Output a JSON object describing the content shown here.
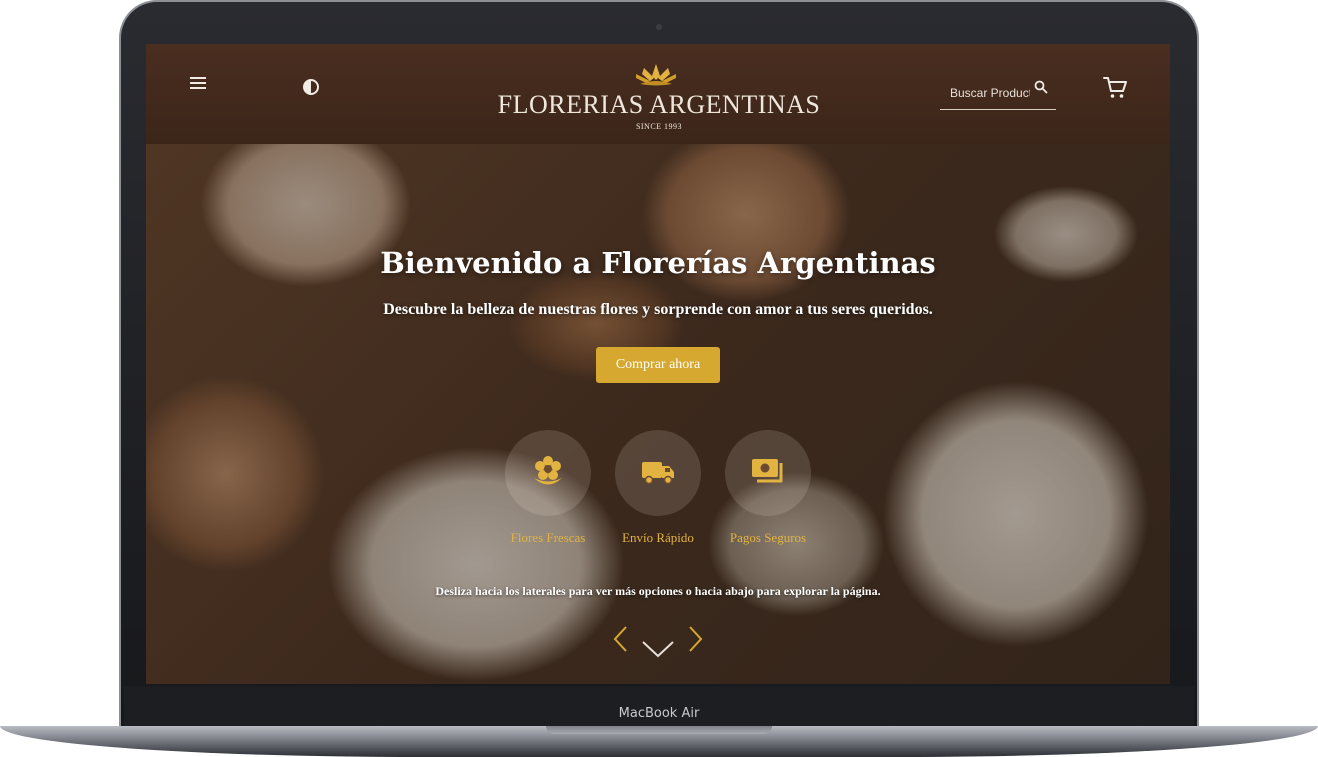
{
  "device": {
    "label": "MacBook Air"
  },
  "header": {
    "logo_name": "FLORERIAS ARGENTINAS",
    "logo_since": "SINCE 1993",
    "search_placeholder": "Buscar Productos",
    "icons": {
      "menu": "hamburger-menu-icon",
      "theme": "theme-toggle-icon",
      "search": "search-icon",
      "cart": "cart-icon",
      "logo": "lotus-flower-icon"
    }
  },
  "hero": {
    "title": "Bienvenido a Florerías Argentinas",
    "subtitle": "Descubre la belleza de nuestras flores y sorprende con amor a tus seres queridos.",
    "cta_label": "Comprar ahora",
    "features": [
      {
        "label": "Flores Frescas",
        "icon": "flower-icon"
      },
      {
        "label": "Envío Rápido",
        "icon": "truck-icon"
      },
      {
        "label": "Pagos Seguros",
        "icon": "money-icon"
      }
    ],
    "hint": "Desliza hacia los laterales para ver más opciones o hacia abajo para explorar la página.",
    "nav_icons": {
      "prev": "chevron-left-icon",
      "down": "chevron-down-icon",
      "next": "chevron-right-icon"
    }
  },
  "colors": {
    "header_bg": "#452b1e",
    "accent": "#d6a82f",
    "feature_label": "#e2b340"
  }
}
